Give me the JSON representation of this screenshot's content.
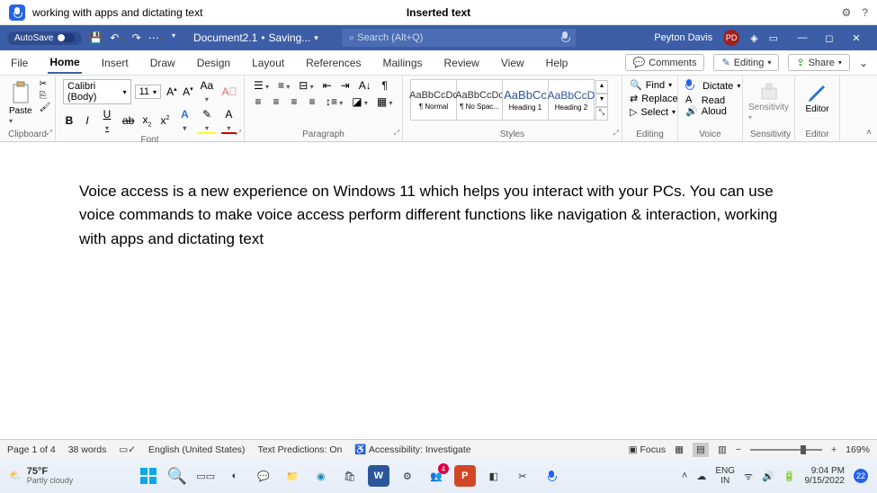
{
  "voice_bar": {
    "command": "working with apps and dictating text",
    "status": "Inserted text"
  },
  "title": {
    "autosave_label": "AutoSave",
    "document": "Document2.1",
    "save_state": "Saving...",
    "search_placeholder": "Search (Alt+Q)",
    "user_name": "Peyton Davis",
    "user_initials": "PD"
  },
  "tabs": {
    "items": [
      "File",
      "Home",
      "Insert",
      "Draw",
      "Design",
      "Layout",
      "References",
      "Mailings",
      "Review",
      "View",
      "Help"
    ],
    "active": "Home",
    "comments": "Comments",
    "editing_mode": "Editing",
    "share": "Share"
  },
  "ribbon": {
    "clipboard": {
      "paste": "Paste",
      "label": "Clipboard"
    },
    "font": {
      "label": "Font",
      "family": "Calibri (Body)",
      "size": "11"
    },
    "paragraph": {
      "label": "Paragraph"
    },
    "styles": {
      "label": "Styles",
      "items": [
        {
          "preview": "AaBbCcDc",
          "name": "¶ Normal"
        },
        {
          "preview": "AaBbCcDc",
          "name": "¶ No Spac..."
        },
        {
          "preview": "AaBbCc",
          "name": "Heading 1"
        },
        {
          "preview": "AaBbCcD",
          "name": "Heading 2"
        }
      ]
    },
    "editing": {
      "label": "Editing",
      "find": "Find",
      "replace": "Replace",
      "select": "Select"
    },
    "voice": {
      "label": "Voice",
      "dictate": "Dictate",
      "read_aloud": "Read Aloud"
    },
    "sensitivity": {
      "label": "Sensitivity",
      "btn": "Sensitivity"
    },
    "editor": {
      "label": "Editor",
      "btn": "Editor"
    }
  },
  "document_body": "Voice access is a new experience on Windows 11 which helps you interact with your PCs. You can use voice commands to make voice access perform different functions like navigation & interaction, working with apps and dictating text",
  "status": {
    "page": "Page 1 of 4",
    "words": "38 words",
    "language": "English (United States)",
    "predictions": "Text Predictions: On",
    "accessibility": "Accessibility: Investigate",
    "focus": "Focus",
    "zoom": "169%"
  },
  "taskbar": {
    "temp": "75°F",
    "weather": "Partly cloudy",
    "lang1": "ENG",
    "lang2": "IN",
    "time": "9:04 PM",
    "date": "9/15/2022",
    "notif_count": "22"
  }
}
